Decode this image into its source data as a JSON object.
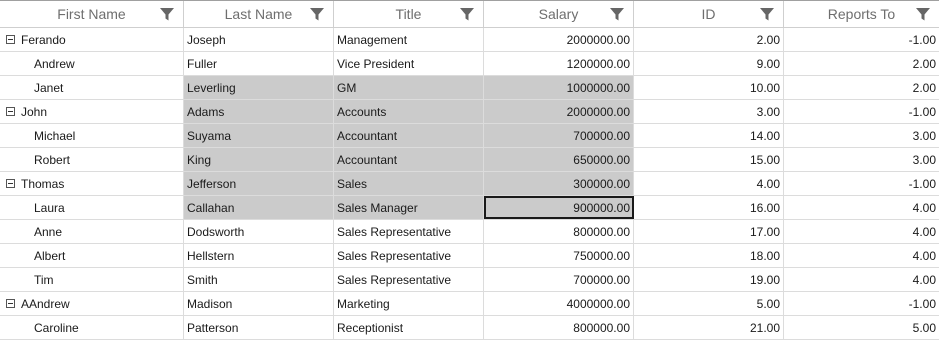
{
  "columns": [
    {
      "label": "First Name"
    },
    {
      "label": "Last Name"
    },
    {
      "label": "Title"
    },
    {
      "label": "Salary"
    },
    {
      "label": "ID"
    },
    {
      "label": "Reports To"
    }
  ],
  "rows": [
    {
      "first": "Ferando",
      "last": "Joseph",
      "title": "Management",
      "salary": "2000000.00",
      "id": "2.00",
      "reports": "-1.00",
      "parent": true,
      "selected": false,
      "current": false
    },
    {
      "first": "Andrew",
      "last": "Fuller",
      "title": "Vice President",
      "salary": "1200000.00",
      "id": "9.00",
      "reports": "2.00",
      "parent": false,
      "selected": false,
      "current": false
    },
    {
      "first": "Janet",
      "last": "Leverling",
      "title": "GM",
      "salary": "1000000.00",
      "id": "10.00",
      "reports": "2.00",
      "parent": false,
      "selected": true,
      "current": false
    },
    {
      "first": "John",
      "last": "Adams",
      "title": "Accounts",
      "salary": "2000000.00",
      "id": "3.00",
      "reports": "-1.00",
      "parent": true,
      "selected": true,
      "current": false
    },
    {
      "first": "Michael",
      "last": "Suyama",
      "title": "Accountant",
      "salary": "700000.00",
      "id": "14.00",
      "reports": "3.00",
      "parent": false,
      "selected": true,
      "current": false
    },
    {
      "first": "Robert",
      "last": "King",
      "title": "Accountant",
      "salary": "650000.00",
      "id": "15.00",
      "reports": "3.00",
      "parent": false,
      "selected": true,
      "current": false
    },
    {
      "first": "Thomas",
      "last": "Jefferson",
      "title": "Sales",
      "salary": "300000.00",
      "id": "4.00",
      "reports": "-1.00",
      "parent": true,
      "selected": true,
      "current": false
    },
    {
      "first": "Laura",
      "last": "Callahan",
      "title": "Sales Manager",
      "salary": "900000.00",
      "id": "16.00",
      "reports": "4.00",
      "parent": false,
      "selected": true,
      "current": true
    },
    {
      "first": "Anne",
      "last": "Dodsworth",
      "title": "Sales Representative",
      "salary": "800000.00",
      "id": "17.00",
      "reports": "4.00",
      "parent": false,
      "selected": false,
      "current": false
    },
    {
      "first": "Albert",
      "last": "Hellstern",
      "title": "Sales Representative",
      "salary": "750000.00",
      "id": "18.00",
      "reports": "4.00",
      "parent": false,
      "selected": false,
      "current": false
    },
    {
      "first": "Tim",
      "last": "Smith",
      "title": "Sales Representative",
      "salary": "700000.00",
      "id": "19.00",
      "reports": "4.00",
      "parent": false,
      "selected": false,
      "current": false
    },
    {
      "first": "AAndrew",
      "last": "Madison",
      "title": "Marketing",
      "salary": "4000000.00",
      "id": "5.00",
      "reports": "-1.00",
      "parent": true,
      "selected": false,
      "current": false
    },
    {
      "first": "Caroline",
      "last": "Patterson",
      "title": "Receptionist",
      "salary": "800000.00",
      "id": "21.00",
      "reports": "5.00",
      "parent": false,
      "selected": false,
      "current": false
    }
  ],
  "colors": {
    "selection": "#cbcbcb",
    "header_text": "#6e6e6e",
    "filter_icon": "#666666"
  },
  "icons": {
    "filter": "filter-icon",
    "toggle": "collapse-toggle-icon"
  }
}
